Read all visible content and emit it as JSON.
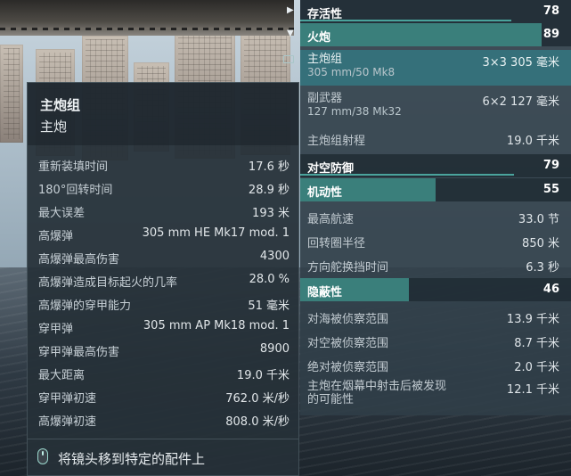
{
  "tooltip": {
    "title": "主炮组",
    "subtitle": "主炮",
    "rows": [
      {
        "label": "重新装填时间",
        "value": "17.6 秒"
      },
      {
        "label": "180°回转时间",
        "value": "28.9 秒"
      },
      {
        "label": "最大误差",
        "value": "193 米"
      },
      {
        "label": "高爆弹",
        "value": "305 mm HE Mk17 mod. 1"
      },
      {
        "label": "高爆弹最高伤害",
        "value": "4300"
      },
      {
        "label": "高爆弹造成目标起火的几率",
        "value": "28.0 %"
      },
      {
        "label": "高爆弹的穿甲能力",
        "value": "51 毫米"
      },
      {
        "label": "穿甲弹",
        "value": "305 mm AP Mk18 mod. 1"
      },
      {
        "label": "穿甲弹最高伤害",
        "value": "8900"
      },
      {
        "label": "最大距离",
        "value": "19.0 千米"
      },
      {
        "label": "穿甲弹初速",
        "value": "762.0 米/秒"
      },
      {
        "label": "高爆弹初速",
        "value": "808.0 米/秒"
      }
    ],
    "footer": "将镜头移到特定的配件上"
  },
  "stats": {
    "survivability": {
      "label": "存活性",
      "value": "78",
      "fill": 0.78
    },
    "artillery": {
      "label": "火炮",
      "value": "89",
      "fill": 0.89,
      "main_battery": {
        "label": "主炮组",
        "sub": "305 mm/50 Mk8",
        "value": "3×3 305 毫米"
      },
      "secondary": {
        "label": "副武器",
        "sub": "127 mm/38 Mk32",
        "value": "6×2 127 毫米"
      },
      "range": {
        "label": "主炮组射程",
        "value": "19.0 千米"
      }
    },
    "aa": {
      "label": "对空防御",
      "value": "79",
      "fill": 0.79
    },
    "maneuverability": {
      "label": "机动性",
      "value": "55",
      "fill": 0.55,
      "rows": [
        {
          "label": "最高航速",
          "value": "33.0 节"
        },
        {
          "label": "回转圈半径",
          "value": "850 米"
        },
        {
          "label": "方向舵换挡时间",
          "value": "6.3 秒"
        }
      ]
    },
    "concealment": {
      "label": "隐蔽性",
      "value": "46",
      "fill": 0.46,
      "rows": [
        {
          "label": "对海被侦察范围",
          "value": "13.9 千米"
        },
        {
          "label": "对空被侦察范围",
          "value": "8.7 千米"
        },
        {
          "label": "绝对被侦察范围",
          "value": "2.0 千米"
        }
      ],
      "smoke": {
        "label_line1": "主炮在烟幕中射击后被发现",
        "label_line2": "的可能性",
        "value": "12.1 千米"
      }
    }
  },
  "colors": {
    "bar": "#3a7f7b",
    "panel": "#303e48",
    "highlight": "#35707a"
  }
}
